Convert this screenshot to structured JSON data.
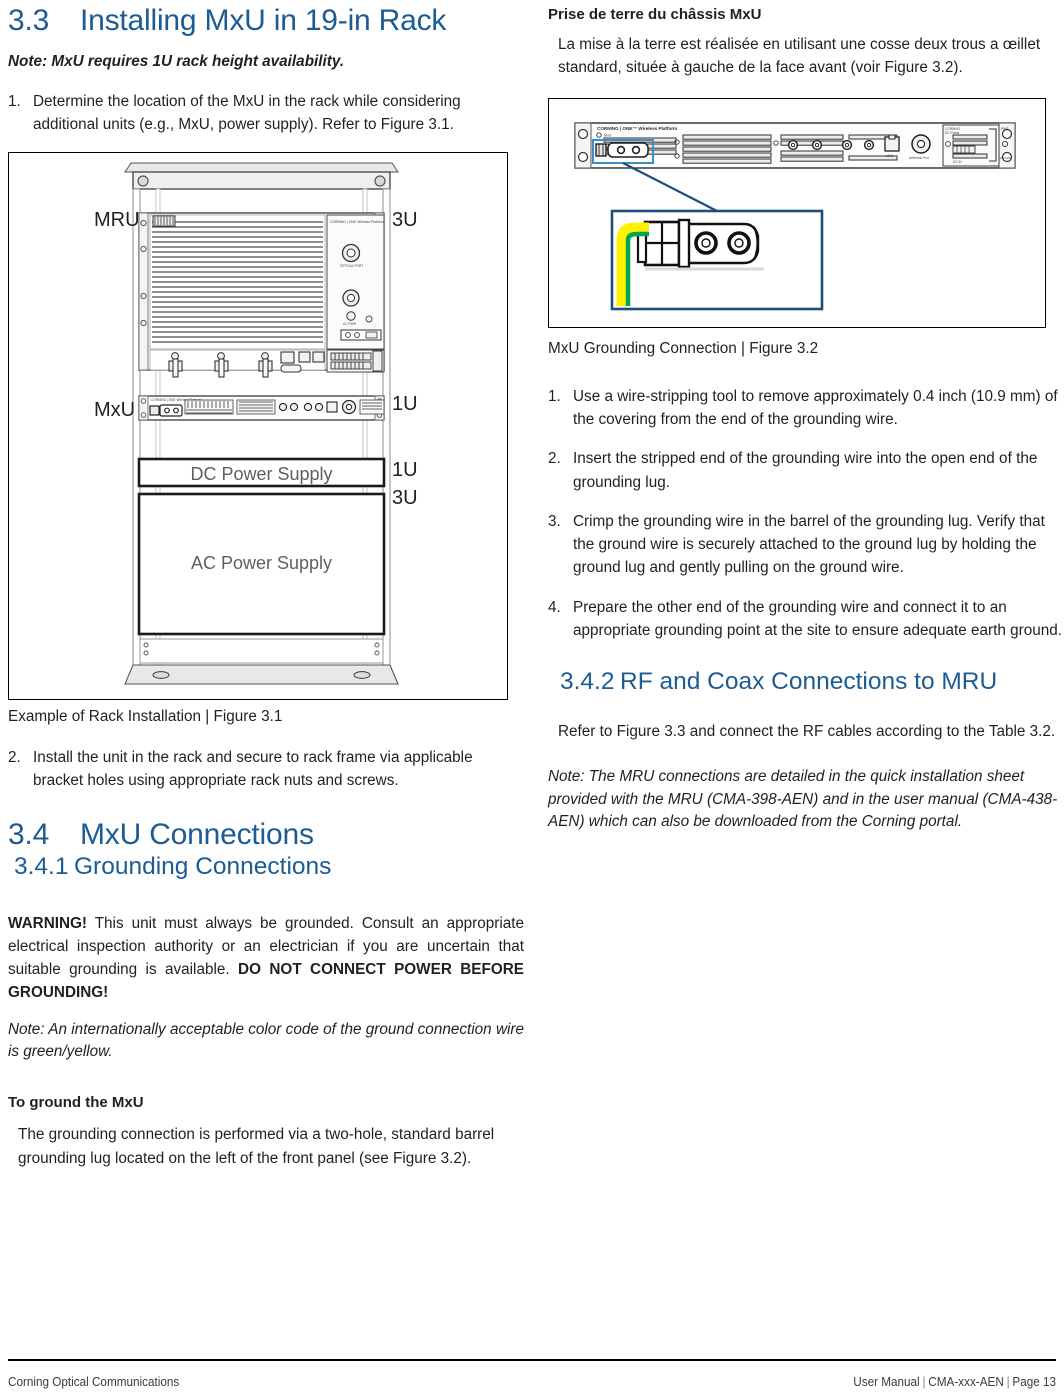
{
  "left": {
    "heading": {
      "number": "3.3",
      "title": "Installing MxU in 19-in Rack"
    },
    "note_top": "Note:  MxU requires 1U rack height availability.",
    "step1": {
      "marker": "1.",
      "text": "Determine the location of the MxU in the rack while considering additional units (e.g., MxU, power supply). Refer to Figure 3.1."
    },
    "figure31": {
      "caption": "Example of Rack Installation | Figure 3.1",
      "label_mru": "MRU",
      "label_mxu": "MxU",
      "label_3u_top": "3U",
      "label_1u_mxu": "1U",
      "label_1u_dc": "1U",
      "label_3u_ac": "3U",
      "dc_supply": "DC Power Supply",
      "ac_supply": "AC Power Supply"
    },
    "step2": {
      "marker": "2.",
      "text": "Install the unit in the rack and secure to rack frame via applicable bracket holes using appropriate rack nuts and screws."
    },
    "heading_34": {
      "number": "3.4",
      "title": "MxU Connections"
    },
    "heading_341": {
      "number": "3.4.1",
      "title": "Grounding Connections"
    },
    "warning": {
      "label": "WARNING!",
      "text_part1": " This unit must always be grounded. Consult an appropriate electrical inspection authority or an electrician if you are uncertain that suitable grounding is available. ",
      "text_bold_tail": "DO NOT CONNECT POWER BEFORE GROUNDING!"
    },
    "note_color": "Note:   An internationally acceptable color code of the ground connection wire is green/yellow.",
    "to_ground_head": "To ground the MxU",
    "to_ground_text": "The grounding connection is performed via a two-hole, standard barrel grounding lug located on the left of the front panel (see Figure 3.2)."
  },
  "right": {
    "fr_head": "Prise de terre du  châssis MxU",
    "fr_text": "La mise à la terre est réalisée en utilisant une cosse deux trous a œillet standard, située à gauche de la face avant  (voir Figure 3.2).",
    "figure32": {
      "caption": "MxU Grounding Connection | Figure 3.2"
    },
    "steps": [
      {
        "marker": "1.",
        "text": "Use a wire-stripping tool to remove approximately 0.4 inch (10.9  mm) of the covering from the end of the grounding wire."
      },
      {
        "marker": "2.",
        "text": "Insert the stripped end of the grounding wire into the open end of the grounding lug."
      },
      {
        "marker": "3.",
        "text": "Crimp the grounding wire in the barrel of the grounding lug. Verify that the ground wire is securely attached to the ground lug by holding the ground lug and gently pulling on the ground wire."
      },
      {
        "marker": "4.",
        "text": "Prepare the other end of the grounding wire and connect it to an appropriate grounding point at the site to ensure adequate earth ground."
      }
    ],
    "heading_342": {
      "number": "3.4.2",
      "title": "RF and Coax Connections to MRU"
    },
    "refer_text": "Refer to Figure 3.3 and connect the RF cables according to the Table 3.2.",
    "note_mru": "Note: The MRU connections are detailed in the quick installation sheet provided with the MRU (CMA-398-AEN) and in the user manual (CMA-438-AEN) which can also be downloaded from the Corning portal."
  },
  "footer": {
    "left": "Corning Optical Communications",
    "manual": "User Manual",
    "part": "CMA-xxx-AEN",
    "page": "Page 13",
    "sep": "|"
  },
  "colors": {
    "heading_blue": "#1c5c94",
    "callout_blue": "#1f4e79",
    "highlight_blue": "#3d8ec9",
    "wire_yellow": "#fff200",
    "wire_green": "#00a650"
  }
}
